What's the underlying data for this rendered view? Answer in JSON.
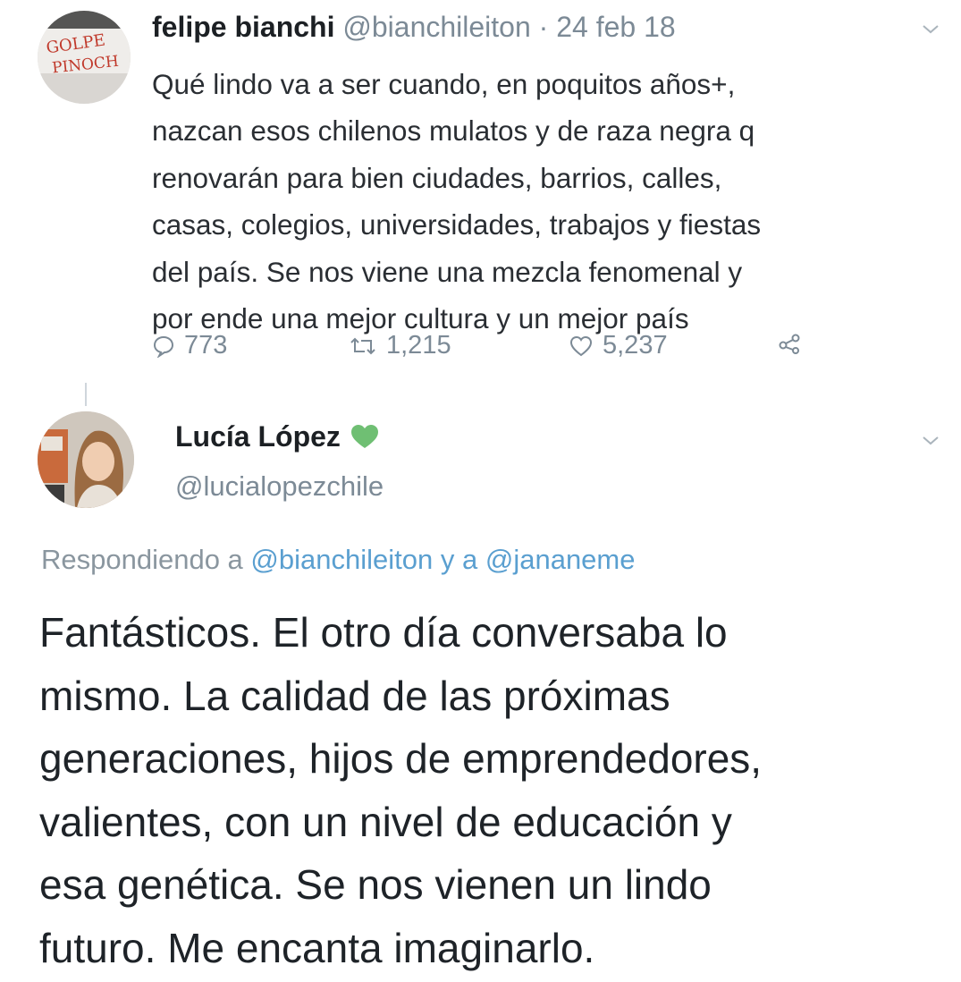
{
  "tweet1": {
    "avatar_text": [
      "GOLPE",
      "PINOCH"
    ],
    "author_name": "felipe bianchi",
    "handle": "@bianchileiton",
    "separator": "·",
    "date": "24 feb 18",
    "body_lines": [
      "Qué lindo va a ser cuando, en poquitos años+,",
      "nazcan esos chilenos mulatos y de raza negra q",
      "renovarán para bien ciudades, barrios, calles,",
      "casas, colegios, universidades, trabajos y fiestas",
      "del país. Se nos viene una mezcla fenomenal y",
      "por ende una mejor cultura y un mejor país"
    ],
    "replies": "773",
    "retweets": "1,215",
    "likes": "5,237",
    "icons": {
      "reply": "reply-icon",
      "retweet": "retweet-icon",
      "like": "heart-icon",
      "share": "share-icon",
      "menu": "chevron-down-icon"
    }
  },
  "tweet2": {
    "author_name": "Lucía López",
    "badge_icon": "green-heart-icon",
    "badge_color": "#6fbf73",
    "handle": "@lucialopezchile",
    "replying_prefix": "Respondiendo a",
    "replying_mention_1": "@bianchileiton",
    "replying_join": "y a",
    "replying_mention_2": "@jananeme",
    "body_lines": [
      "Fantásticos. El otro día conversaba lo",
      "mismo. La calidad de las próximas",
      "generaciones, hijos de emprendedores,",
      "valientes, con un nivel de educación y",
      "esa genética. Se nos vienen un lindo",
      "futuro. Me encanta imaginarlo."
    ]
  },
  "colors": {
    "text": "#1c2024",
    "muted": "#7c8a96",
    "link": "#5a9fd0"
  }
}
